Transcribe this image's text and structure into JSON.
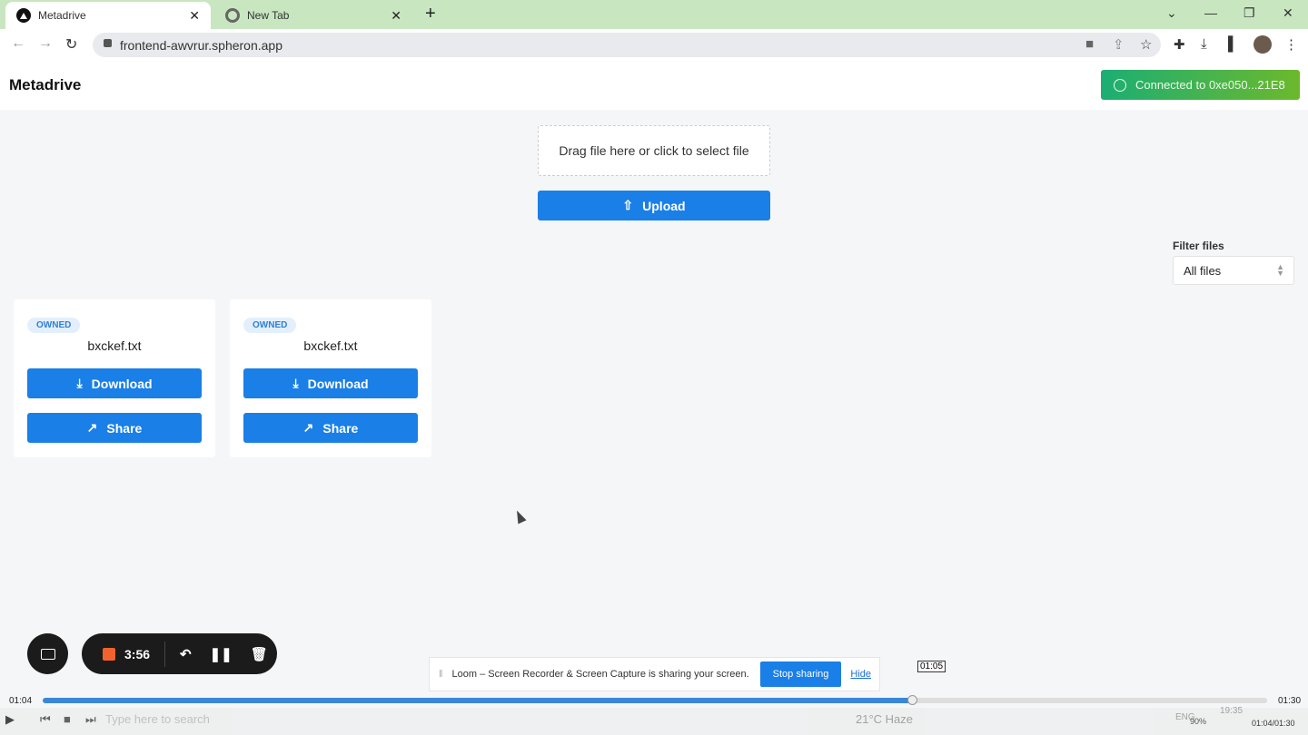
{
  "browser": {
    "tabs": [
      {
        "title": "Metadrive",
        "active": true
      },
      {
        "title": "New Tab",
        "active": false
      }
    ],
    "url": "frontend-awvrur.spheron.app"
  },
  "app": {
    "brand": "Metadrive",
    "wallet": "Connected to 0xe050...21E8",
    "dropzone": "Drag file here or click to select file",
    "upload_label": "Upload",
    "filter": {
      "label": "Filter files",
      "value": "All files"
    },
    "files": [
      {
        "badge": "OWNED",
        "name": "bxckef.txt",
        "download": "Download",
        "share": "Share"
      },
      {
        "badge": "OWNED",
        "name": "bxckef.txt",
        "download": "Download",
        "share": "Share"
      }
    ],
    "colors": {
      "primary": "#1a7fe6",
      "connected_from": "#1cae74",
      "connected_to": "#6cb82c"
    }
  },
  "loom": {
    "timer": "3:56",
    "banner": "Loom – Screen Recorder & Screen Capture is sharing your screen.",
    "stop": "Stop sharing",
    "hide": "Hide"
  },
  "player": {
    "current": "01:04",
    "total": "01:30",
    "hover": "01:05",
    "progress_percent": 71,
    "readout": "01:04/01:30"
  },
  "taskbar": {
    "search": "Type here to search",
    "weather": "21°C  Haze",
    "lang": "ENG",
    "clock": "19:35",
    "volume": "90%"
  }
}
